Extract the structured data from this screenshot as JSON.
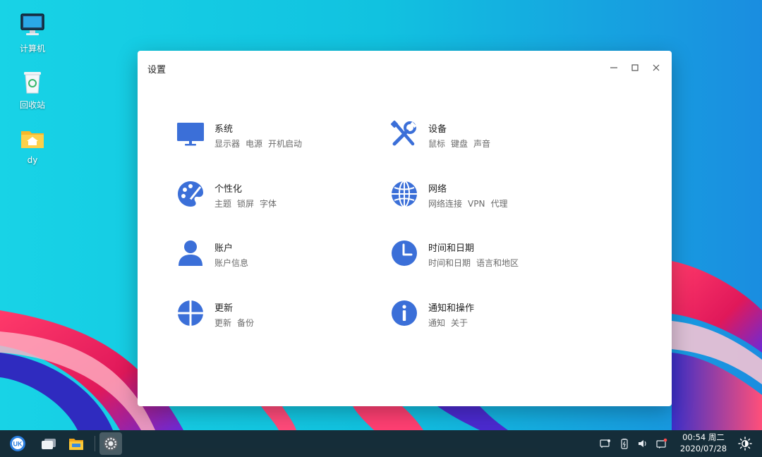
{
  "desktop": {
    "icons": [
      {
        "label": "计算机",
        "icon": "computer-icon"
      },
      {
        "label": "回收站",
        "icon": "trash-icon"
      },
      {
        "label": "dy",
        "icon": "home-folder-icon"
      }
    ]
  },
  "window": {
    "title": "设置",
    "controls": [
      "minimize-icon",
      "maximize-icon",
      "close-icon"
    ],
    "modules": [
      {
        "title": "系统",
        "subs": [
          "显示器",
          "电源",
          "开机启动"
        ],
        "icon": "monitor-icon"
      },
      {
        "title": "设备",
        "subs": [
          "鼠标",
          "键盘",
          "声音"
        ],
        "icon": "tools-icon"
      },
      {
        "title": "个性化",
        "subs": [
          "主题",
          "锁屏",
          "字体"
        ],
        "icon": "palette-icon"
      },
      {
        "title": "网络",
        "subs": [
          "网络连接",
          "VPN",
          "代理"
        ],
        "icon": "globe-icon"
      },
      {
        "title": "账户",
        "subs": [
          "账户信息"
        ],
        "icon": "user-icon"
      },
      {
        "title": "时间和日期",
        "subs": [
          "时间和日期",
          "语言和地区"
        ],
        "icon": "clock-icon"
      },
      {
        "title": "更新",
        "subs": [
          "更新",
          "备份"
        ],
        "icon": "update-icon"
      },
      {
        "title": "通知和操作",
        "subs": [
          "通知",
          "关于"
        ],
        "icon": "info-icon"
      }
    ],
    "accent": "#3b6fd8"
  },
  "taskbar": {
    "apps": [
      "start-menu-icon",
      "multitask-view-icon",
      "file-manager-icon",
      "settings-app-icon"
    ],
    "tray": [
      "screen-cast-icon",
      "battery-icon",
      "volume-icon",
      "notification-icon"
    ],
    "clock": {
      "time": "00:54 周二",
      "date": "2020/07/28"
    },
    "theme_icon": "brightness-icon"
  }
}
